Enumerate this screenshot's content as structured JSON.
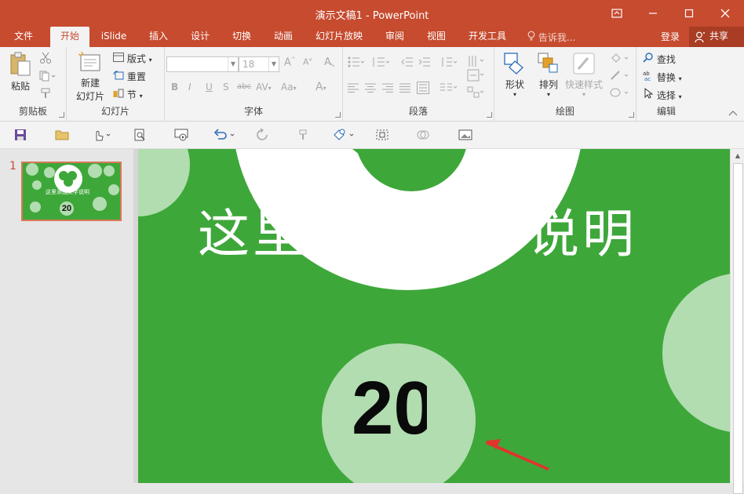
{
  "window": {
    "title": "演示文稿1 - PowerPoint"
  },
  "tabs": [
    {
      "label": "文件",
      "active": false
    },
    {
      "label": "开始",
      "active": true
    },
    {
      "label": "iSlide",
      "active": false
    },
    {
      "label": "插入",
      "active": false
    },
    {
      "label": "设计",
      "active": false
    },
    {
      "label": "切换",
      "active": false
    },
    {
      "label": "动画",
      "active": false
    },
    {
      "label": "幻灯片放映",
      "active": false
    },
    {
      "label": "审阅",
      "active": false
    },
    {
      "label": "视图",
      "active": false
    },
    {
      "label": "开发工具",
      "active": false
    }
  ],
  "tell_me": "告诉我...",
  "login": "登录",
  "share": "共享",
  "ribbon": {
    "clipboard": {
      "label": "剪贴板",
      "paste": "粘贴"
    },
    "slides": {
      "label": "幻灯片",
      "new_slide_line1": "新建",
      "new_slide_line2": "幻灯片",
      "layout": "版式",
      "reset": "重置",
      "section": "节"
    },
    "font": {
      "label": "字体",
      "font_name": "",
      "font_size": "18"
    },
    "paragraph": {
      "label": "段落"
    },
    "drawing": {
      "label": "绘图",
      "shapes": "形状",
      "arrange": "排列",
      "quick_styles": "快速样式"
    },
    "editing": {
      "label": "编辑",
      "find": "查找",
      "replace": "替换",
      "select": "选择"
    }
  },
  "thumbnail": {
    "number": "1",
    "title": "这里添加文字说明",
    "year": "20"
  },
  "slide": {
    "title": "这里添加文字说明",
    "year": "20"
  },
  "colors": {
    "accent": "#c64b2f",
    "slide_green": "#3ea73a",
    "light_green": "#b1ddb0",
    "arrow_red": "#e0342c"
  }
}
